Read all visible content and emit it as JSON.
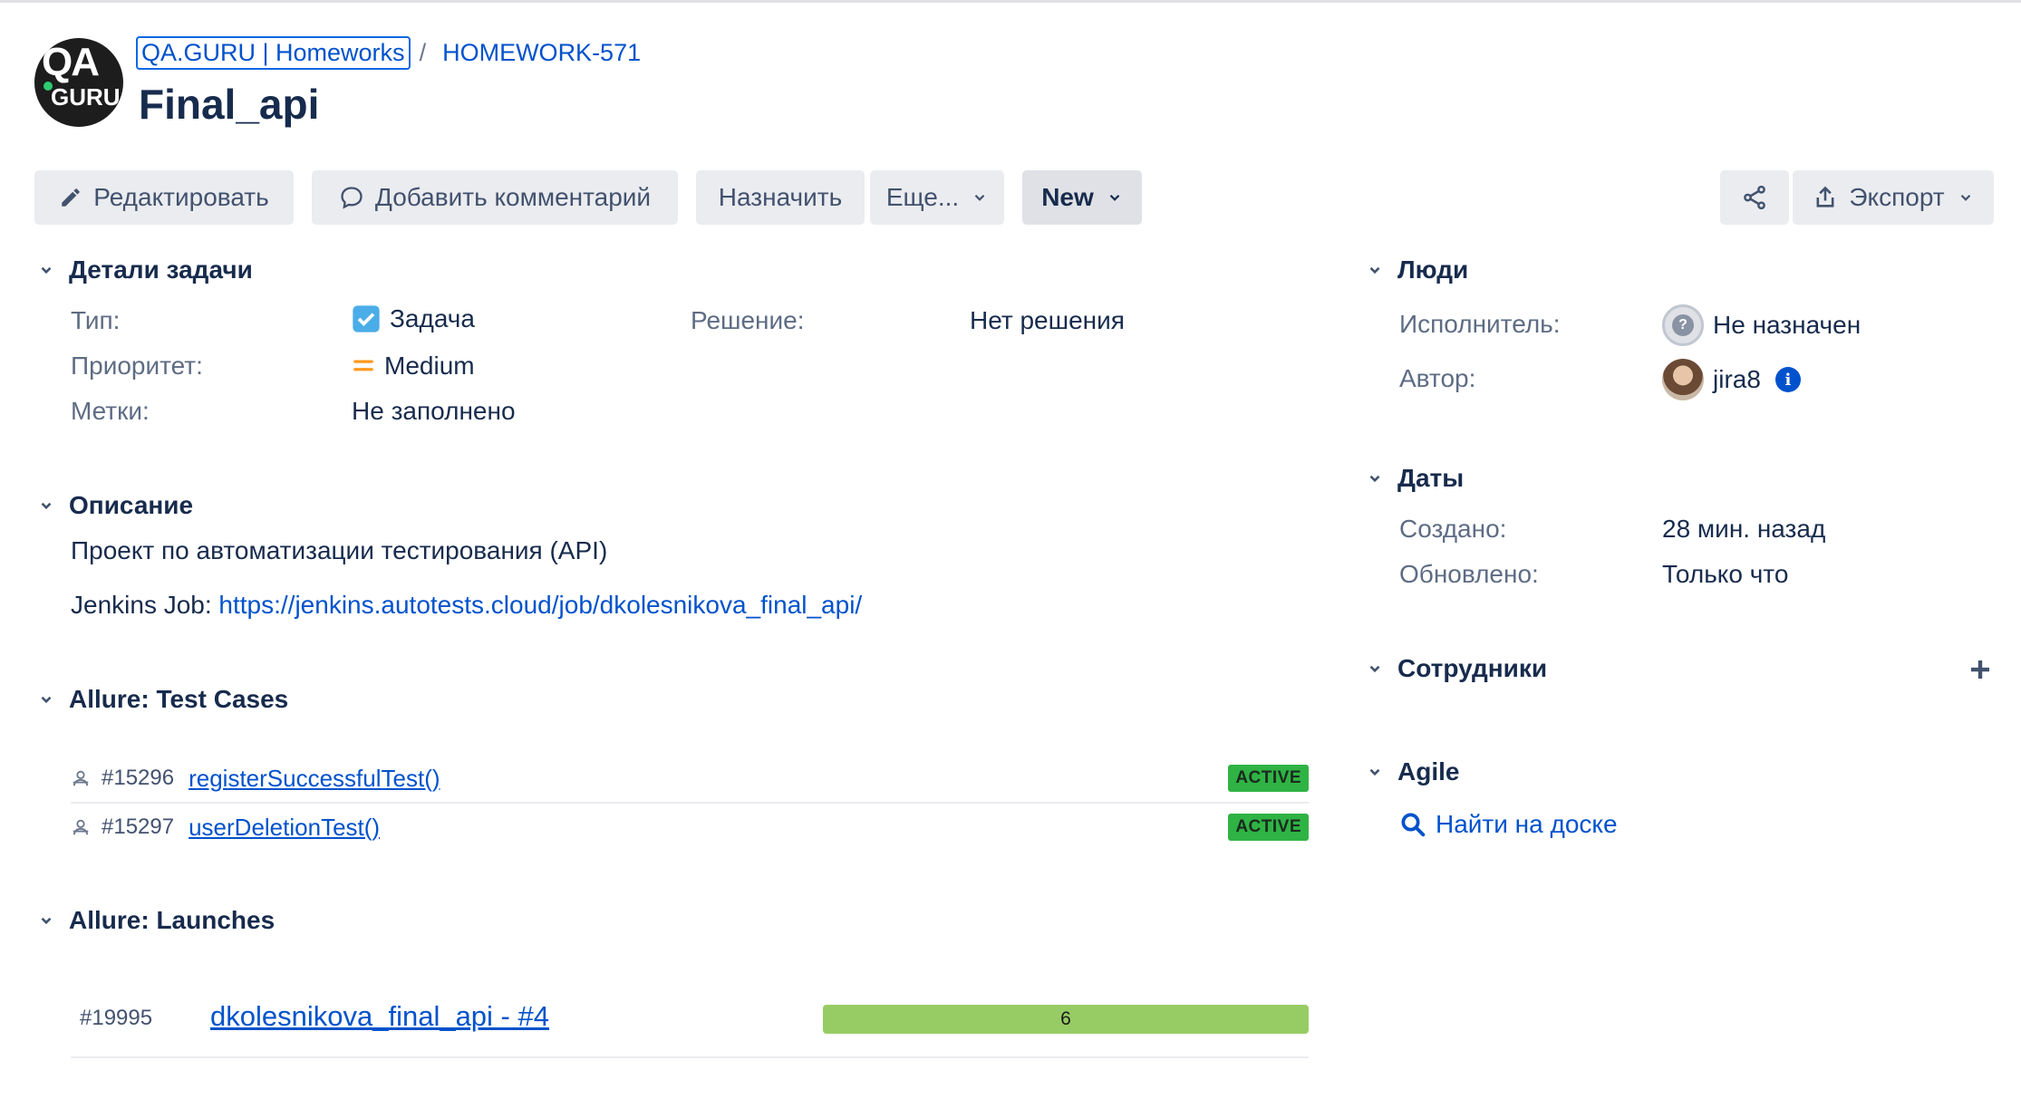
{
  "header": {
    "breadcrumb_project": "QA.GURU | Homeworks",
    "breadcrumb_separator": "/",
    "breadcrumb_issue": "HOMEWORK-571",
    "title": "Final_api",
    "logo_top": "QA",
    "logo_bottom": "GURU"
  },
  "toolbar": {
    "edit": "Редактировать",
    "comment": "Добавить комментарий",
    "assign": "Назначить",
    "more": "Еще...",
    "status": "New",
    "export": "Экспорт"
  },
  "details": {
    "heading": "Детали задачи",
    "type_label": "Тип:",
    "type_value": "Задача",
    "priority_label": "Приоритет:",
    "priority_value": "Medium",
    "labels_label": "Метки:",
    "labels_value": "Не заполнено",
    "resolution_label": "Решение:",
    "resolution_value": "Нет решения"
  },
  "description": {
    "heading": "Описание",
    "line1": "Проект по автоматизации тестирования (API)",
    "jenkins_prefix": "Jenkins Job: ",
    "jenkins_url": "https://jenkins.autotests.cloud/job/dkolesnikova_final_api/"
  },
  "allure_cases": {
    "heading": "Allure: Test Cases",
    "items": [
      {
        "id": "#15296",
        "name": "registerSuccessfulTest()",
        "status": "ACTIVE"
      },
      {
        "id": "#15297",
        "name": "userDeletionTest()",
        "status": "ACTIVE"
      }
    ]
  },
  "allure_launches": {
    "heading": "Allure: Launches",
    "items": [
      {
        "id": "#19995",
        "name": "dkolesnikova_final_api - #4",
        "passed": "6",
        "passed_fraction": 1.0
      }
    ]
  },
  "people": {
    "heading": "Люди",
    "assignee_label": "Исполнитель:",
    "assignee_value": "Не назначен",
    "reporter_label": "Автор:",
    "reporter_value": "jira8"
  },
  "dates": {
    "heading": "Даты",
    "created_label": "Создано:",
    "created_value": "28 мин. назад",
    "updated_label": "Обновлено:",
    "updated_value": "Только что"
  },
  "employees": {
    "heading": "Сотрудники"
  },
  "agile": {
    "heading": "Agile",
    "find_on_board": "Найти на доске"
  },
  "colors": {
    "link": "#0052cc",
    "text": "#172b4d",
    "label": "#5e6c84",
    "badge_active": "#2fb344",
    "launch_passed": "#97cc64",
    "priority_medium": "#ff991f"
  }
}
